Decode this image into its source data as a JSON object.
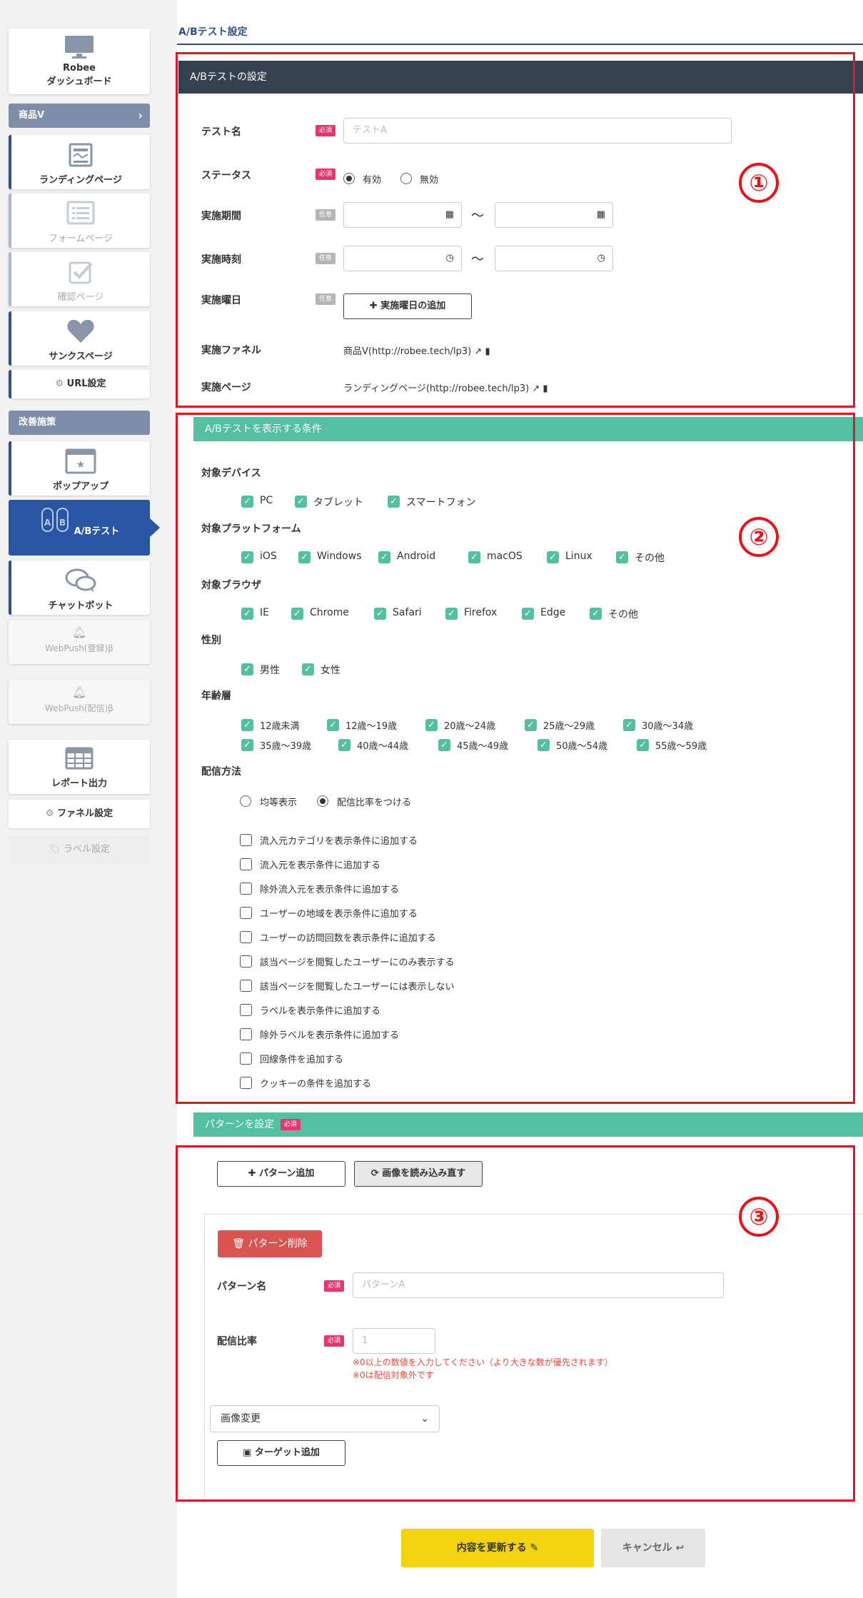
{
  "sidebar": {
    "dashboard": {
      "line1": "Robee",
      "line2": "ダッシュボード"
    },
    "product_header": "商品V",
    "items": [
      {
        "label": "ランディングページ"
      },
      {
        "label": "フォームページ"
      },
      {
        "label": "確認ページ"
      },
      {
        "label": "サンクスページ"
      }
    ],
    "url_settings": "URL設定",
    "improvement_header": "改善施策",
    "popup": "ポップアップ",
    "abtest": "A/Bテスト",
    "chatbot": "チャットボット",
    "webpush_reg": "WebPush(登録)β",
    "webpush_dist": "WebPush(配信)β",
    "report": "レポート出力",
    "funnel_settings": "ファネル設定",
    "label_settings": "ラベル設定"
  },
  "breadcrumb": "A/Bテスト設定",
  "section1": {
    "title": "A/Bテストの設定",
    "test_name_label": "テスト名",
    "test_name_placeholder": "テストA",
    "status_label": "ステータス",
    "status_on": "有効",
    "status_off": "無効",
    "period_label": "実施期間",
    "time_label": "実施時刻",
    "weekday_label": "実施曜日",
    "weekday_button": "実施曜日の追加",
    "funnel_label": "実施ファネル",
    "funnel_value": "商品V(http://robee.tech/lp3)",
    "page_label": "実施ページ",
    "page_value": "ランディングページ(http://robee.tech/lp3)",
    "required": "必須",
    "optional": "任意",
    "tilde": "〜"
  },
  "section2": {
    "title": "A/Bテストを表示する条件",
    "device_label": "対象デバイス",
    "devices": [
      "PC",
      "タブレット",
      "スマートフォン"
    ],
    "platform_label": "対象プラットフォーム",
    "platforms": [
      "iOS",
      "Windows",
      "Android",
      "macOS",
      "Linux",
      "その他"
    ],
    "browser_label": "対象ブラウザ",
    "browsers": [
      "IE",
      "Chrome",
      "Safari",
      "Firefox",
      "Edge",
      "その他"
    ],
    "gender_label": "性別",
    "genders": [
      "男性",
      "女性"
    ],
    "age_label": "年齢層",
    "ages_row1": [
      "12歳未満",
      "12歳〜19歳",
      "20歳〜24歳",
      "25歳〜29歳",
      "30歳〜34歳"
    ],
    "ages_row2": [
      "35歳〜39歳",
      "40歳〜44歳",
      "45歳〜49歳",
      "50歳〜54歳",
      "55歳〜59歳"
    ],
    "delivery_label": "配信方法",
    "delivery_equal": "均等表示",
    "delivery_ratio": "配信比率をつける",
    "conditions": [
      "流入元カテゴリを表示条件に追加する",
      "流入元を表示条件に追加する",
      "除外流入元を表示条件に追加する",
      "ユーザーの地域を表示条件に追加する",
      "ユーザーの訪問回数を表示条件に追加する",
      "該当ページを閲覧したユーザーにのみ表示する",
      "該当ページを閲覧したユーザーには表示しない",
      "ラベルを表示条件に追加する",
      "除外ラベルを表示条件に追加する",
      "回線条件を追加する",
      "クッキーの条件を追加する"
    ]
  },
  "section3": {
    "title": "パターンを設定",
    "required": "必須",
    "add_pattern": "パターン追加",
    "reload_images": "画像を読み込み直す",
    "delete_pattern": "パターン削除",
    "pattern_name_label": "パターン名",
    "pattern_name_placeholder": "パターンA",
    "ratio_label": "配信比率",
    "ratio_placeholder": "1",
    "note1": "※0以上の数値を入力してください（より大きな数が優先されます）",
    "note2": "※0は配信対象外です",
    "select_value": "画像変更",
    "add_target": "ターゲット追加"
  },
  "annotations": {
    "n1": "①",
    "n2": "②",
    "n3": "③"
  },
  "footer": {
    "update": "内容を更新する",
    "cancel": "キャンセル"
  },
  "colors": {
    "navy": "#2d4f8c",
    "green": "#52c0a1",
    "dark": "#35414e",
    "red": "#e8141a",
    "yellow": "#f3d20f"
  }
}
